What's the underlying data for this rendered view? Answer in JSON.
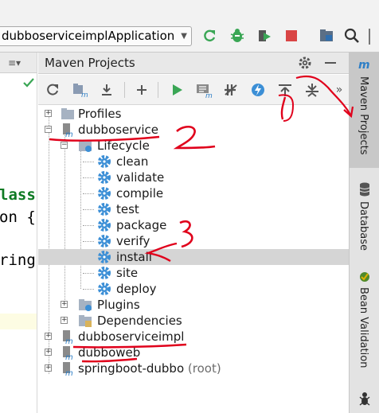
{
  "toolbar": {
    "run_config": "dubboserviceimplApplication",
    "icons": [
      "refresh-icon",
      "debug-bug-icon",
      "coverage-icon",
      "stop-icon",
      "project-structure-icon",
      "search-icon"
    ]
  },
  "editor": {
    "lines": [
      "lass",
      "on {",
      "ring"
    ]
  },
  "panel": {
    "title": "Maven Projects"
  },
  "tree": {
    "profiles": "Profiles",
    "dubboservice": "dubboservice",
    "lifecycle": "Lifecycle",
    "goals": [
      "clean",
      "validate",
      "compile",
      "test",
      "package",
      "verify",
      "install",
      "site",
      "deploy"
    ],
    "plugins": "Plugins",
    "dependencies": "Dependencies",
    "dubboserviceimpl": "dubboserviceimpl",
    "dubboweb": "dubboweb",
    "springboot_name": "springboot-dubbo",
    "springboot_suffix": "(root)"
  },
  "stripe": {
    "maven": "Maven Projects",
    "database": "Database",
    "bean": "Bean Validation"
  },
  "annotations": {
    "n1": "1",
    "n2": "2",
    "n3": "3"
  },
  "colors": {
    "annotation_red": "#e0001b",
    "gear_blue": "#3c8fd6",
    "run_green": "#3aa655",
    "selection_gray": "#d5d5d5"
  }
}
